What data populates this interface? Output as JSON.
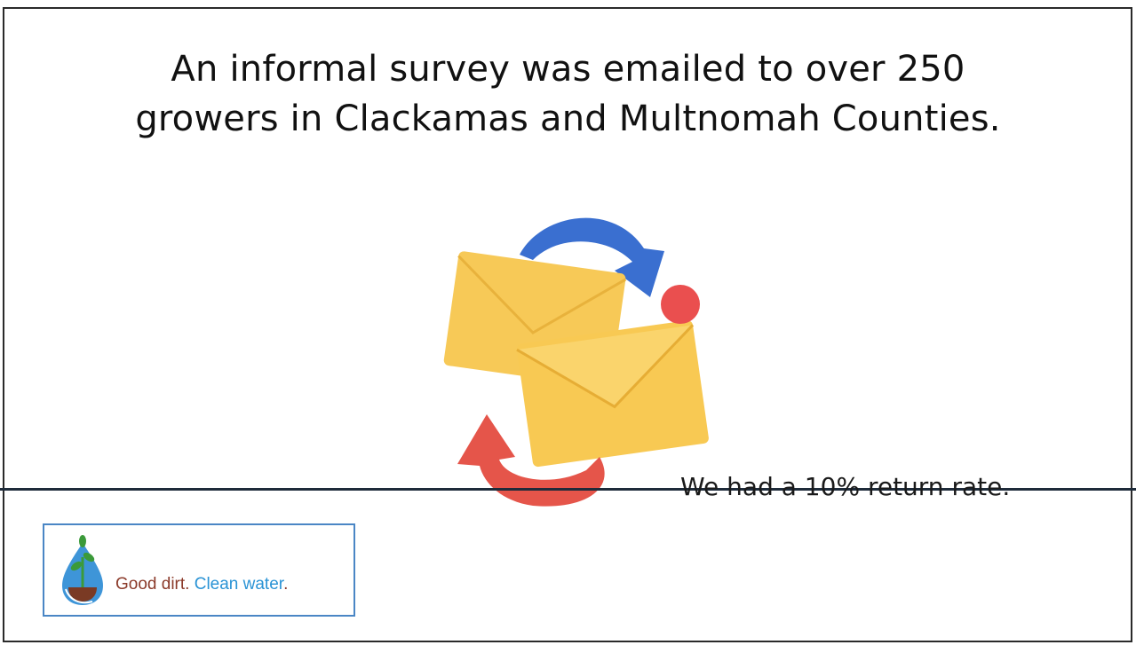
{
  "slide": {
    "title_line1": "An informal survey was emailed to over 250",
    "title_line2": "growers in Clackamas and Multnomah Counties.",
    "return_rate": "We had a 10% return rate."
  },
  "illustration": {
    "icon": "email-exchange-icon",
    "colors": {
      "envelope": "#f6c24a",
      "arrow_top": "#3a6fd0",
      "arrow_bottom": "#e5554a",
      "dot": "#ea4f4f"
    }
  },
  "logo": {
    "icon": "water-drop-sprout-icon",
    "tag_part1": "Good dirt.",
    "tag_part2": "Clean water",
    "tag_period": ".",
    "colors": {
      "dirt": "#8b3a2a",
      "water": "#2a93d5",
      "leaf": "#3b9a3a"
    }
  }
}
